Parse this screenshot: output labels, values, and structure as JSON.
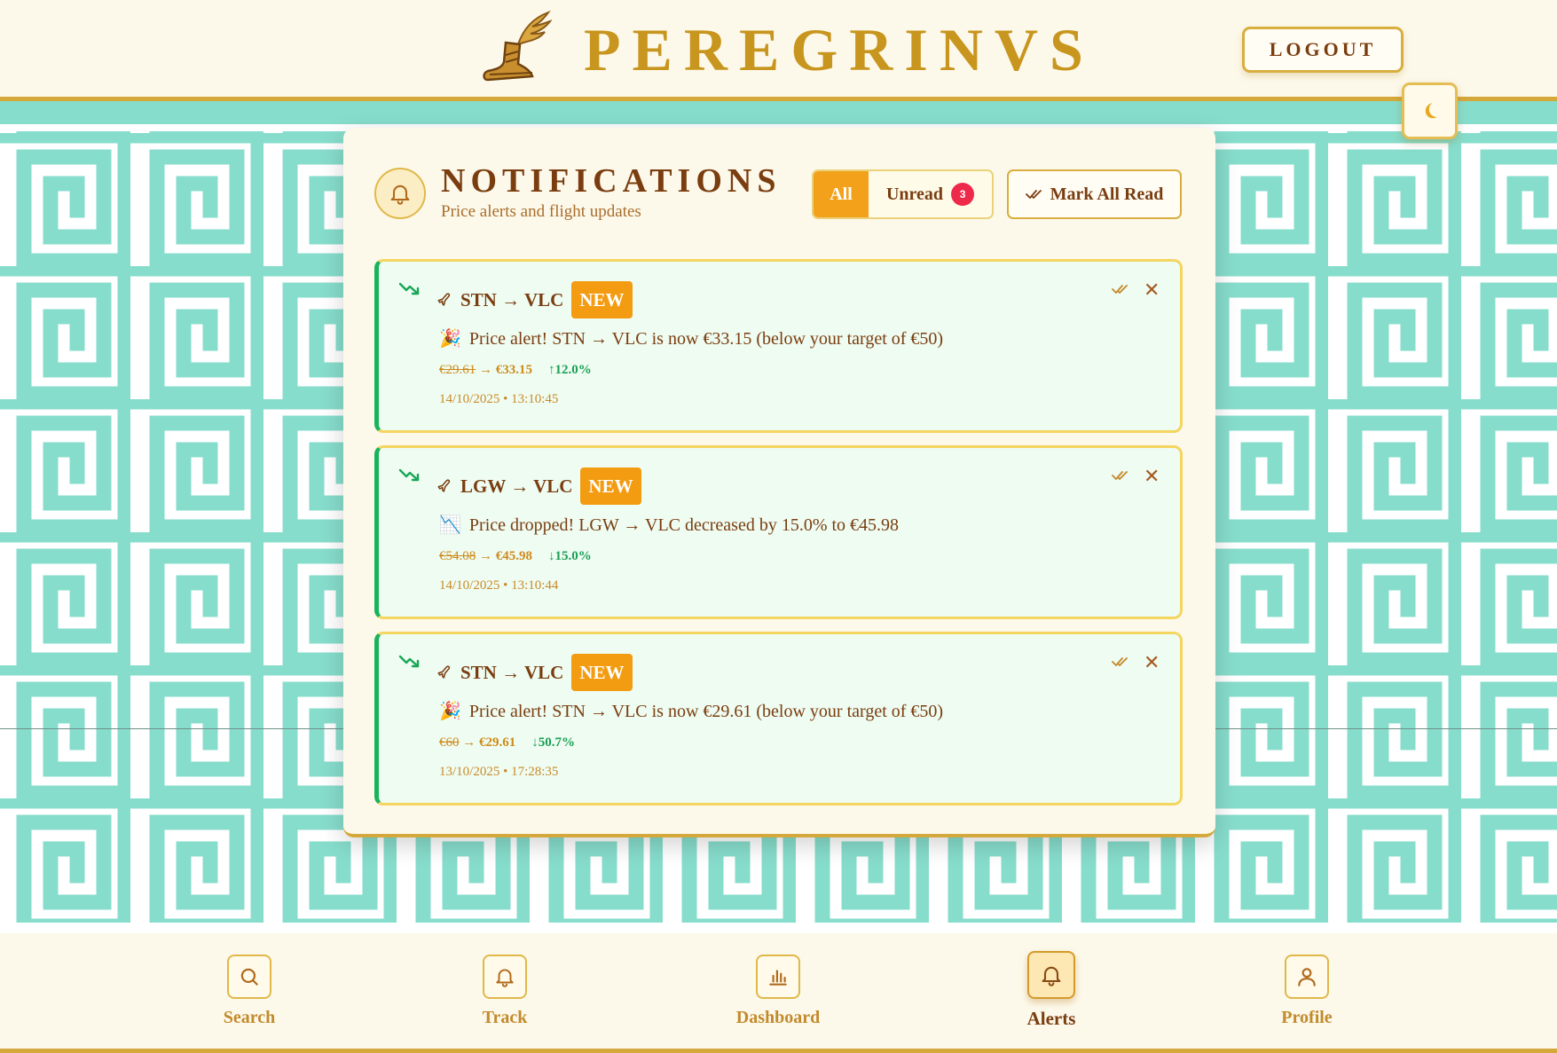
{
  "header": {
    "brand": "PEREGRINVS",
    "logout_label": "LOGOUT",
    "theme_toggle_icon": "moon-icon"
  },
  "notifications": {
    "title": "NOTIFICATIONS",
    "subtitle": "Price alerts and flight updates",
    "filters": {
      "all_label": "All",
      "unread_label": "Unread",
      "unread_count": "3",
      "active": "All"
    },
    "mark_all_label": "Mark All Read",
    "items": [
      {
        "route": "STN → VLC",
        "badge": "NEW",
        "emoji": "🎉",
        "message": "Price alert! STN → VLC is now €33.15 (below your target of €50)",
        "old_price": "€29.61",
        "arrow": "→",
        "new_price": "€33.15",
        "change": "↑12.0%",
        "timestamp": "14/10/2025 • 13:10:45"
      },
      {
        "route": "LGW → VLC",
        "badge": "NEW",
        "emoji": "📉",
        "message": "Price dropped! LGW → VLC decreased by 15.0% to €45.98",
        "old_price": "€54.08",
        "arrow": "→",
        "new_price": "€45.98",
        "change": "↓15.0%",
        "timestamp": "14/10/2025 • 13:10:44"
      },
      {
        "route": "STN → VLC",
        "badge": "NEW",
        "emoji": "🎉",
        "message": "Price alert! STN → VLC is now €29.61 (below your target of €50)",
        "old_price": "€60",
        "arrow": "→",
        "new_price": "€29.61",
        "change": "↓50.7%",
        "timestamp": "13/10/2025 • 17:28:35"
      }
    ]
  },
  "bottom_nav": {
    "active": "Alerts",
    "items": [
      {
        "label": "Search",
        "icon": "search-icon"
      },
      {
        "label": "Track",
        "icon": "bell-icon"
      },
      {
        "label": "Dashboard",
        "icon": "bar-chart-icon"
      },
      {
        "label": "Alerts",
        "icon": "bell-icon"
      },
      {
        "label": "Profile",
        "icon": "user-icon"
      }
    ]
  },
  "colors": {
    "gold": "#c8961f",
    "brown": "#7a3d10",
    "orange": "#f3a11b",
    "green": "#19b35c",
    "teal_pattern": "#87ddcc",
    "red_badge": "#ee2a4a"
  }
}
